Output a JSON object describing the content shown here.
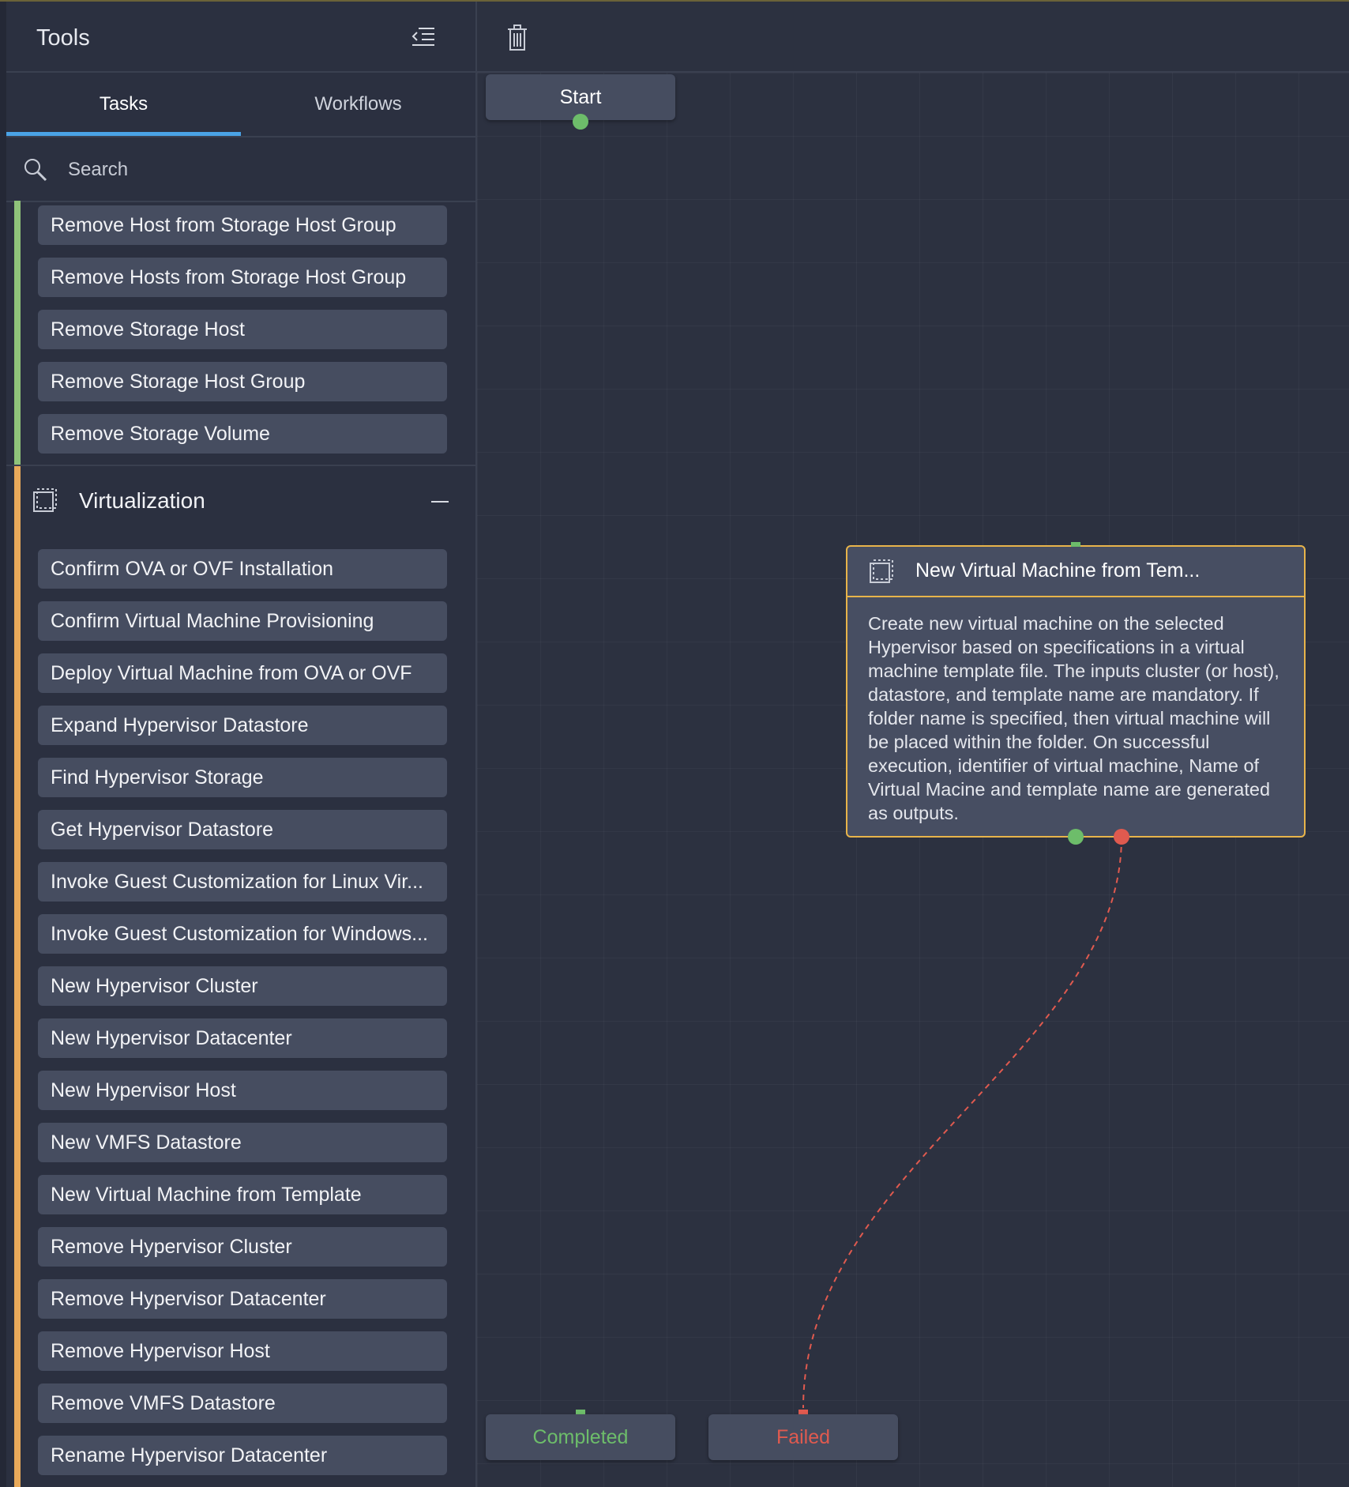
{
  "sidebar": {
    "title": "Tools",
    "tabs": [
      {
        "label": "Tasks",
        "active": true
      },
      {
        "label": "Workflows",
        "active": false
      }
    ],
    "search": {
      "placeholder": "Search",
      "value": ""
    },
    "storage_items": [
      "Remove Host from Storage Host Group",
      "Remove Hosts from Storage Host Group",
      "Remove Storage Host",
      "Remove Storage Host Group",
      "Remove Storage Volume"
    ],
    "virtualization": {
      "title": "Virtualization",
      "items": [
        "Confirm OVA or OVF Installation",
        "Confirm Virtual Machine Provisioning",
        "Deploy Virtual Machine from OVA or OVF",
        "Expand Hypervisor Datastore",
        "Find Hypervisor Storage",
        "Get Hypervisor Datastore",
        "Invoke Guest Customization for Linux Vir...",
        "Invoke Guest Customization for Windows...",
        "New Hypervisor Cluster",
        "New Hypervisor Datacenter",
        "New Hypervisor Host",
        "New VMFS Datastore",
        "New Virtual Machine from Template",
        "Remove Hypervisor Cluster",
        "Remove Hypervisor Datacenter",
        "Remove Hypervisor Host",
        "Remove VMFS Datastore",
        "Rename Hypervisor Datacenter"
      ]
    }
  },
  "canvas": {
    "start_label": "Start",
    "completed_label": "Completed",
    "failed_label": "Failed",
    "task_node": {
      "title": "New Virtual Machine from Tem...",
      "description": "Create new virtual machine on the selected Hypervisor based on specifications in a virtual machine template file. The inputs cluster (or host), datastore, and template name are mandatory. If folder name is specified, then virtual machine will be placed within the folder. On successful execution, identifier of virtual machine, Name of Virtual Macine and template name are generated as outputs."
    }
  },
  "colors": {
    "accent_tab": "#4aa3e6",
    "storage_group": "#8fc37a",
    "virtualization_group": "#e8a95a",
    "success": "#6dbd6a",
    "failure": "#e05a4f",
    "selected_border": "#e8b44a"
  },
  "icons": {
    "collapse_sidebar": "collapse-sidebar-icon",
    "search": "search-icon",
    "virtualization": "virtualization-icon",
    "section_collapse": "minus-icon",
    "delete": "trash-icon",
    "task": "task-node-icon"
  }
}
